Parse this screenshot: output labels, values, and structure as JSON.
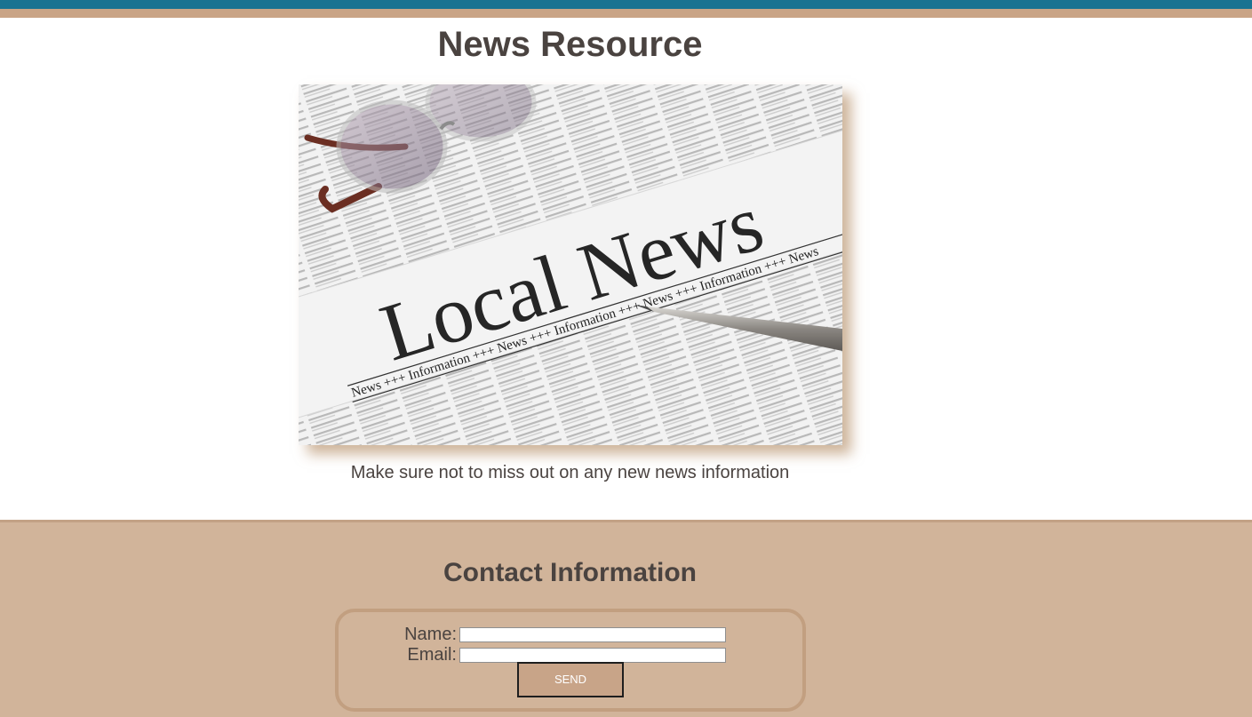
{
  "page": {
    "title": "News Resource",
    "tagline": "Make sure not to miss out on any new news information"
  },
  "hero_image": {
    "headline": "Local News",
    "ticker": "News +++ Information +++ News +++ Information +++ News +++ Information +++ News"
  },
  "contact": {
    "title": "Contact Information",
    "name_label": "Name:",
    "name_value": "",
    "email_label": "Email:",
    "email_value": "",
    "send_label": "SEND"
  },
  "colors": {
    "header_teal": "#1a7391",
    "header_tan": "#c9a486",
    "contact_bg": "#d1b49a",
    "text": "#4a4340"
  }
}
